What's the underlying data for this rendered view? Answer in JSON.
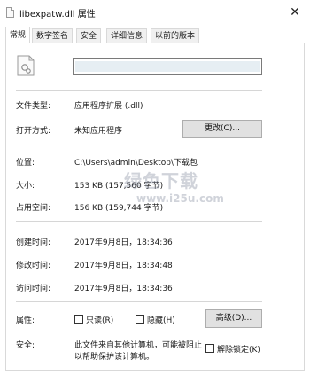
{
  "window": {
    "title": "libexpatw.dll 属性",
    "close_glyph": "✕"
  },
  "tabs": [
    "常规",
    "数字签名",
    "安全",
    "详细信息",
    "以前的版本"
  ],
  "general": {
    "file_type_label": "文件类型:",
    "file_type_value": "应用程序扩展 (.dll)",
    "opens_with_label": "打开方式:",
    "opens_with_value": "未知应用程序",
    "change_button": "更改(C)...",
    "location_label": "位置:",
    "location_value": "C:\\Users\\admin\\Desktop\\下载包",
    "size_label": "大小:",
    "size_value": "153 KB (157,560 字节)",
    "size_on_disk_label": "占用空间:",
    "size_on_disk_value": "156 KB (159,744 字节)",
    "created_label": "创建时间:",
    "created_value": "2017年9月8日，18:34:36",
    "modified_label": "修改时间:",
    "modified_value": "2017年9月8日，18:34:48",
    "accessed_label": "访问时间:",
    "accessed_value": "2017年9月8日，18:34:36",
    "attributes_label": "属性:",
    "readonly_label": "只读(R)",
    "hidden_label": "隐藏(H)",
    "advanced_button": "高级(D)...",
    "security_label": "安全:",
    "security_text_1": "此文件来自其他计算机，可能被阻止",
    "security_text_2": "以帮助保护该计算机。",
    "unblock_label": "解除锁定(K)"
  },
  "watermark": {
    "text": "绿色下载",
    "url": "www.i25u.com"
  },
  "icons": {
    "file_icon": "dll-file-icon"
  }
}
